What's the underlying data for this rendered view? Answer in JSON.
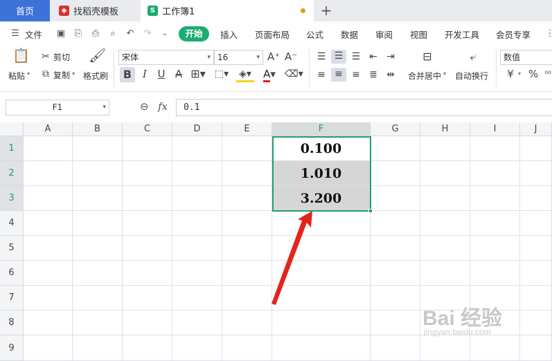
{
  "tabs": {
    "home": "首页",
    "template": "找稻壳模板",
    "workbook": "工作簿1",
    "add": "+"
  },
  "menu": {
    "file": "文件",
    "items": [
      "开始",
      "插入",
      "页面布局",
      "公式",
      "数据",
      "审阅",
      "视图",
      "开发工具",
      "会员专享"
    ]
  },
  "ribbon": {
    "paste": "粘贴",
    "cut": "剪切",
    "copy": "复制",
    "format_painter": "格式刷",
    "font_name": "宋体",
    "font_size": "16",
    "merge_center": "合并居中",
    "wrap_text": "自动换行",
    "number_format": "数值",
    "bold": "B",
    "italic": "I",
    "underline": "U",
    "strikethrough": "A",
    "currency": "¥",
    "percent": "%"
  },
  "formula_bar": {
    "name_box": "F1",
    "fx": "fx",
    "content": "0.1"
  },
  "columns": [
    "A",
    "B",
    "C",
    "D",
    "E",
    "F",
    "G",
    "H",
    "I",
    "J"
  ],
  "rows": [
    "1",
    "2",
    "3",
    "4",
    "5",
    "6",
    "7",
    "8",
    "9"
  ],
  "cells": {
    "F1": "0.100",
    "F2": "1.010",
    "F3": "3.200"
  },
  "selection": "F1:F3",
  "watermark": {
    "text": "Bai 经验",
    "sub": "jingyan.baidu.com"
  },
  "colors": {
    "accent_green": "#1fa06a",
    "tab_blue": "#3d73d9",
    "arrow_red": "#e3241b"
  }
}
